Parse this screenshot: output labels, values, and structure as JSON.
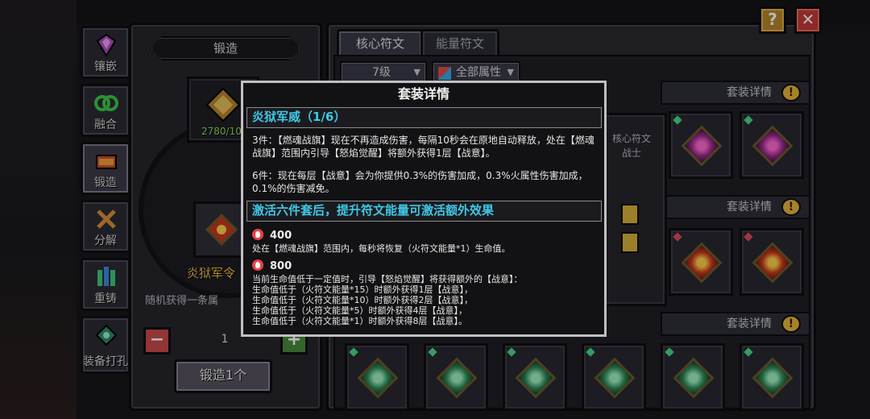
{
  "tabs": [
    {
      "label": "镶嵌",
      "icon": "inlay-icon"
    },
    {
      "label": "融合",
      "icon": "fusion-icon"
    },
    {
      "label": "锻造",
      "icon": "forge-icon"
    },
    {
      "label": "分解",
      "icon": "decompose-icon"
    },
    {
      "label": "重铸",
      "icon": "recast-icon"
    },
    {
      "label": "装备打孔",
      "icon": "socket-icon"
    }
  ],
  "forge": {
    "title": "锻造",
    "progress": "2780/10",
    "item_name": "炎狱军令",
    "random_text": "随机获得一条属",
    "quantity": "1",
    "button_label": "锻造1个"
  },
  "right_panel": {
    "tab_core": "核心符文",
    "tab_energy": "能量符文",
    "filter_level": "7级",
    "filter_attr": "全部属性",
    "set_details_label": "套装详情",
    "side_card_text": [
      "核心符文",
      "战士"
    ]
  },
  "buttons": {
    "help": "?",
    "close": "✕"
  },
  "modal": {
    "title": "套装详情",
    "set_name": "炎狱军威（1/6）",
    "effect3": "3件：【燃魂战旗】现在不再造成伤害，每隔10秒会在原地自动释放，处在【燃魂战旗】范围内引导【怒焰觉醒】将额外获得1层【战意】。",
    "effect6": "6件：现在每层【战意】会为你提供0.3%的伤害加成，0.3%火属性伤害加成，0.1%的伤害减免。",
    "activate_header": "激活六件套后，提升符文能量可激活额外效果",
    "energy1_value": "400",
    "energy1_text": "处在【燃魂战旗】范围内，每秒将恢复（火符文能量*1）生命值。",
    "energy2_value": "800",
    "energy2_text": "当前生命值低于一定值时，引导【怒焰觉醒】将获得额外的【战意】：\n生命值低于（火符文能量*15）时额外获得1层【战意】，\n生命值低于（火符文能量*10）时额外获得2层【战意】，\n生命值低于（火符文能量*5）时额外获得4层【战意】，\n生命值低于（火符文能量*1）时额外获得8层【战意】。"
  },
  "colors": {
    "accent_cyan": "#3ec8e6",
    "gold": "#e7b63a",
    "close_red": "#c43a3a"
  }
}
